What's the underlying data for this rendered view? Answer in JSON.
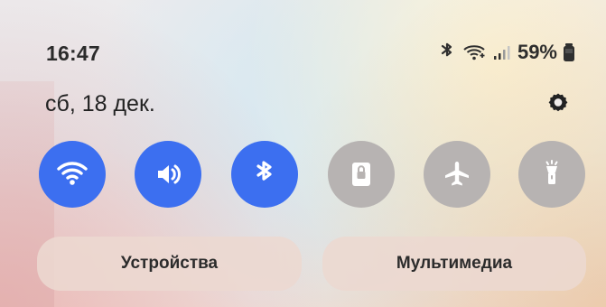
{
  "status_bar": {
    "time": "16:47",
    "battery_percent": "59%",
    "icons": [
      "bluetooth-icon",
      "wifi-calling-icon",
      "signal-icon",
      "battery-icon"
    ]
  },
  "header": {
    "date": "сб, 18 дек."
  },
  "quick_toggles": [
    {
      "name": "wifi",
      "icon": "wifi-icon",
      "active": true
    },
    {
      "name": "sound",
      "icon": "speaker-icon",
      "active": true
    },
    {
      "name": "bluetooth",
      "icon": "bluetooth-icon",
      "active": true
    },
    {
      "name": "screen-lock",
      "icon": "lock-screen-icon",
      "active": false
    },
    {
      "name": "airplane-mode",
      "icon": "airplane-icon",
      "active": false
    },
    {
      "name": "flashlight",
      "icon": "flashlight-icon",
      "active": false
    }
  ],
  "bottom_buttons": {
    "devices_label": "Устройства",
    "media_label": "Мультимедиа"
  },
  "colors": {
    "active": "#3c6ff0",
    "inactive": "#b7b3b2"
  }
}
